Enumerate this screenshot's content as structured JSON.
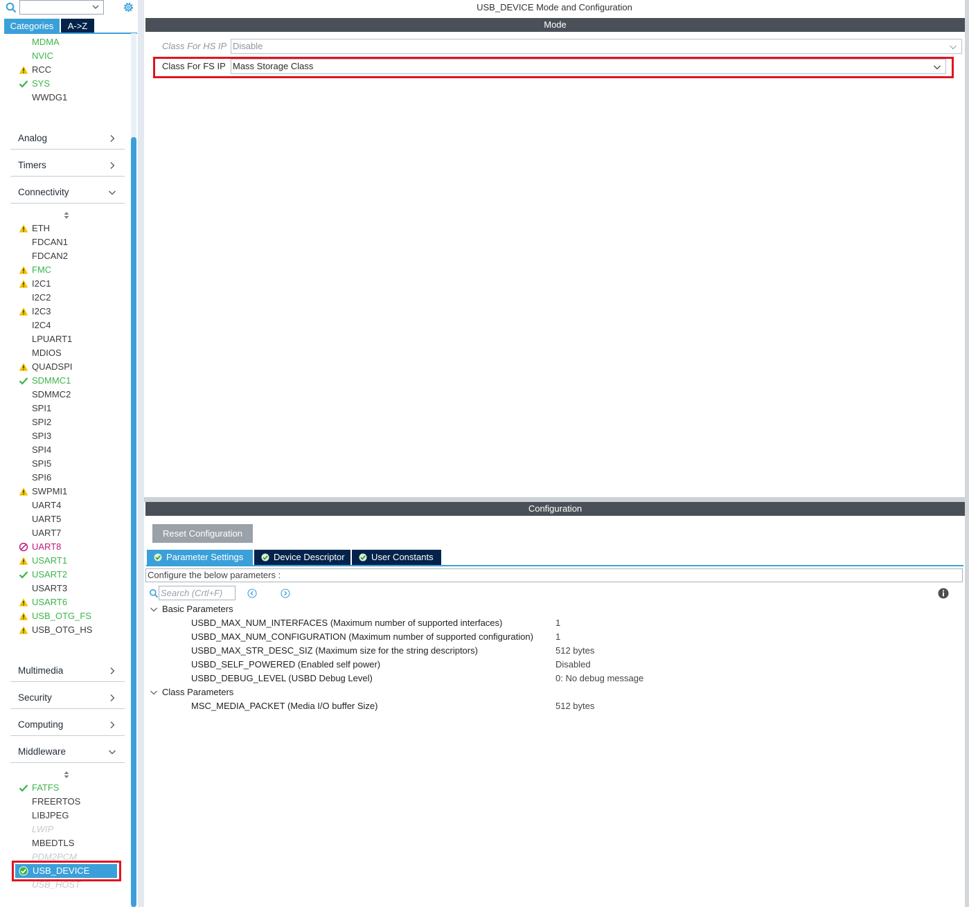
{
  "sidebar": {
    "search": {
      "value": ""
    },
    "tabs": [
      {
        "label": "Categories"
      },
      {
        "label": "A->Z"
      }
    ],
    "top_items": [
      {
        "label": "MDMA",
        "status": "green"
      },
      {
        "label": "NVIC",
        "status": "green"
      },
      {
        "label": "RCC",
        "status": "warning"
      },
      {
        "label": "SYS",
        "status": "ok"
      },
      {
        "label": "WWDG1",
        "status": "none"
      }
    ],
    "categories": {
      "analog": "Analog",
      "timers": "Timers",
      "connectivity": "Connectivity",
      "multimedia": "Multimedia",
      "security": "Security",
      "computing": "Computing",
      "middleware": "Middleware"
    },
    "connectivity_items": [
      {
        "label": "ETH",
        "status": "warning"
      },
      {
        "label": "FDCAN1",
        "status": "none"
      },
      {
        "label": "FDCAN2",
        "status": "none"
      },
      {
        "label": "FMC",
        "status": "warning-green"
      },
      {
        "label": "I2C1",
        "status": "warning"
      },
      {
        "label": "I2C2",
        "status": "none"
      },
      {
        "label": "I2C3",
        "status": "warning"
      },
      {
        "label": "I2C4",
        "status": "none"
      },
      {
        "label": "LPUART1",
        "status": "none"
      },
      {
        "label": "MDIOS",
        "status": "none"
      },
      {
        "label": "QUADSPI",
        "status": "warning"
      },
      {
        "label": "SDMMC1",
        "status": "ok"
      },
      {
        "label": "SDMMC2",
        "status": "none"
      },
      {
        "label": "SPI1",
        "status": "none"
      },
      {
        "label": "SPI2",
        "status": "none"
      },
      {
        "label": "SPI3",
        "status": "none"
      },
      {
        "label": "SPI4",
        "status": "none"
      },
      {
        "label": "SPI5",
        "status": "none"
      },
      {
        "label": "SPI6",
        "status": "none"
      },
      {
        "label": "SWPMI1",
        "status": "warning"
      },
      {
        "label": "UART4",
        "status": "none"
      },
      {
        "label": "UART5",
        "status": "none"
      },
      {
        "label": "UART7",
        "status": "none"
      },
      {
        "label": "UART8",
        "status": "blocked"
      },
      {
        "label": "USART1",
        "status": "warning-green"
      },
      {
        "label": "USART2",
        "status": "ok"
      },
      {
        "label": "USART3",
        "status": "none"
      },
      {
        "label": "USART6",
        "status": "warning-green"
      },
      {
        "label": "USB_OTG_FS",
        "status": "warning-green"
      },
      {
        "label": "USB_OTG_HS",
        "status": "warning"
      }
    ],
    "middleware_items": [
      {
        "label": "FATFS",
        "status": "ok"
      },
      {
        "label": "FREERTOS",
        "status": "none"
      },
      {
        "label": "LIBJPEG",
        "status": "none"
      },
      {
        "label": "LWIP",
        "status": "disabled"
      },
      {
        "label": "MBEDTLS",
        "status": "none"
      },
      {
        "label": "PDM2PCM",
        "status": "disabled"
      },
      {
        "label": "USB_DEVICE",
        "status": "selected"
      },
      {
        "label": "USB_HOST",
        "status": "disabled"
      }
    ]
  },
  "main": {
    "title": "USB_DEVICE Mode and Configuration",
    "mode_header": "Mode",
    "mode_rows": [
      {
        "label": "Class For HS IP",
        "value": "Disable"
      },
      {
        "label": "Class For FS IP",
        "value": "Mass Storage Class"
      }
    ],
    "config_header": "Configuration",
    "reset_label": "Reset Configuration",
    "tabs": [
      {
        "label": "Parameter Settings"
      },
      {
        "label": "Device Descriptor"
      },
      {
        "label": "User Constants"
      }
    ],
    "description": "Configure the below parameters :",
    "search_placeholder": "Search (Crtl+F)",
    "groups": [
      {
        "name": "Basic Parameters",
        "params": [
          {
            "name": "USBD_MAX_NUM_INTERFACES (Maximum number of supported interfaces)",
            "value": "1"
          },
          {
            "name": "USBD_MAX_NUM_CONFIGURATION (Maximum number of supported configuration)",
            "value": "1"
          },
          {
            "name": "USBD_MAX_STR_DESC_SIZ (Maximum size for the string descriptors)",
            "value": "512 bytes"
          },
          {
            "name": "USBD_SELF_POWERED (Enabled self power)",
            "value": "Disabled"
          },
          {
            "name": "USBD_DEBUG_LEVEL (USBD Debug Level)",
            "value": "0: No debug message"
          }
        ]
      },
      {
        "name": "Class Parameters",
        "params": [
          {
            "name": "MSC_MEDIA_PACKET (Media I/O buffer Size)",
            "value": "512 bytes"
          }
        ]
      }
    ]
  },
  "colors": {
    "accent": "#3ba0d9",
    "tab_dark": "#03234b",
    "header_bar": "#4a5057",
    "highlight": "#e0151f",
    "ok_green": "#3db54a",
    "warning_yellow": "#f2c200",
    "blocked_magenta": "#c0187c"
  }
}
